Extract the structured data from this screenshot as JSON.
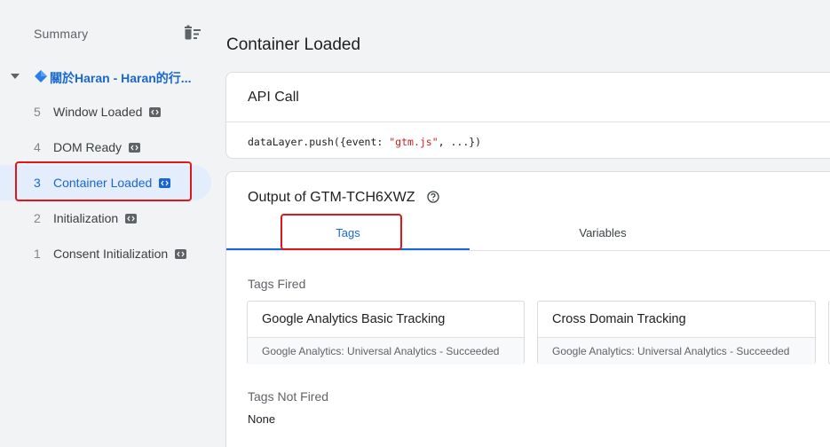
{
  "sidebar": {
    "summary_label": "Summary",
    "page_title": "關於Haran - Haran的行...",
    "events": [
      {
        "num": "5",
        "name": "Window Loaded"
      },
      {
        "num": "4",
        "name": "DOM Ready"
      },
      {
        "num": "3",
        "name": "Container Loaded"
      },
      {
        "num": "2",
        "name": "Initialization"
      },
      {
        "num": "1",
        "name": "Consent Initialization"
      }
    ]
  },
  "main": {
    "title": "Container Loaded",
    "api_call": {
      "header": "API Call",
      "code_prefix": "dataLayer.push({event: ",
      "code_string": "\"gtm.js\"",
      "code_suffix": ", ...})"
    },
    "output": {
      "header": "Output of GTM-TCH6XWZ",
      "tabs": {
        "tags": "Tags",
        "variables": "Variables"
      },
      "tags_fired_label": "Tags Fired",
      "tags_fired": [
        {
          "name": "Google Analytics Basic Tracking",
          "sub": "Google Analytics: Universal Analytics - Succeeded"
        },
        {
          "name": "Cross Domain Tracking",
          "sub": "Google Analytics: Universal Analytics - Succeeded"
        }
      ],
      "tags_not_fired_label": "Tags Not Fired",
      "tags_not_fired_value": "None"
    }
  },
  "colors": {
    "accent": "#1967d2",
    "highlight": "#e0161b",
    "selected_bg": "#e3edfb",
    "string": "#c5221f"
  },
  "icons": {
    "trash": "delete-sweep-icon",
    "page": "blue-diamond-icon",
    "help": "help-circle-icon",
    "code": "code-icon"
  }
}
